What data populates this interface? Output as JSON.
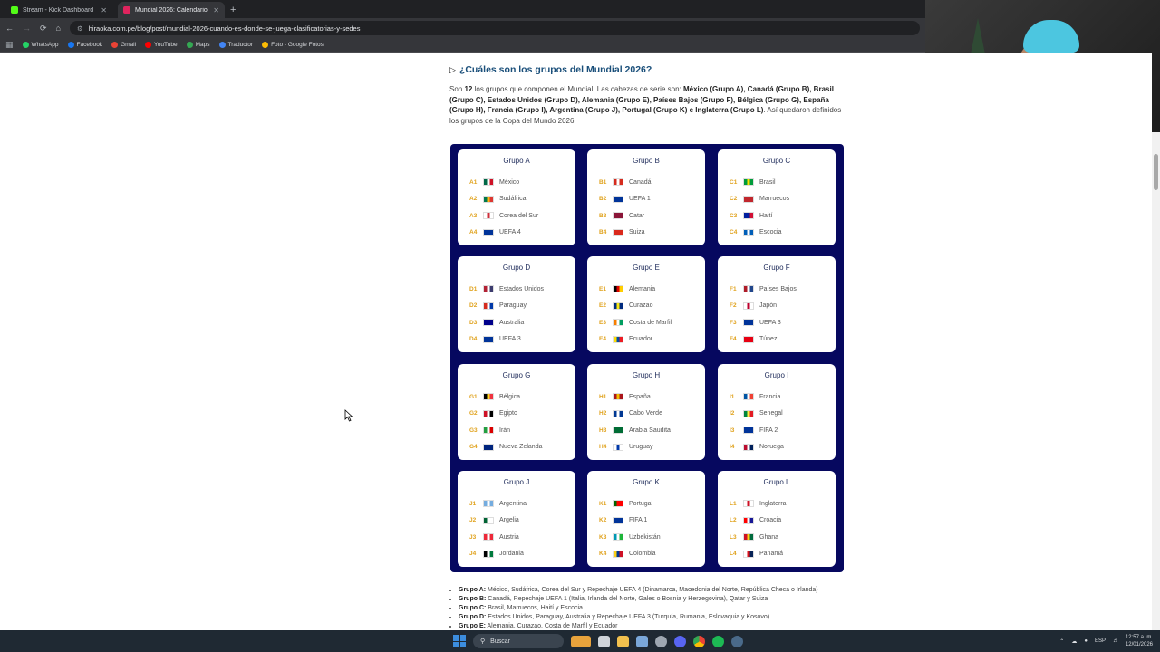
{
  "browser": {
    "tabs": [
      {
        "title": "Stream - Kick Dashboard",
        "color": "#53fc18",
        "active": false
      },
      {
        "title": "Mundial 2026: Calendario co",
        "color": "#e0245e",
        "active": true
      }
    ],
    "url": "hiraoka.com.pe/blog/post/mundial-2026-cuando-es-donde-se-juega-clasificatorias-y-sedes",
    "bookmarks": [
      {
        "label": "WhatsApp",
        "color": "#25d366"
      },
      {
        "label": "Facebook",
        "color": "#1877f2"
      },
      {
        "label": "Gmail",
        "color": "#ea4335"
      },
      {
        "label": "YouTube",
        "color": "#ff0000"
      },
      {
        "label": "Maps",
        "color": "#34a853"
      },
      {
        "label": "Traductor",
        "color": "#4285f4"
      },
      {
        "label": "Foto - Google Fotos",
        "color": "#fbbc05"
      }
    ]
  },
  "article": {
    "question": "¿Cuáles son los grupos del Mundial 2026?",
    "intro_parts": [
      {
        "t": "Son ",
        "b": false
      },
      {
        "t": "12",
        "b": true
      },
      {
        "t": " los grupos que componen el Mundial. Las cabezas de serie son: ",
        "b": false
      },
      {
        "t": "México (Grupo A), Canadá (Grupo B), Brasil (Grupo C), Estados Unidos (Grupo D), Alemania (Grupo E), Países Bajos (Grupo F), Bélgica (Grupo G), España (Grupo H), Francia (Grupo I), Argentina (Grupo J), Portugal (Grupo K) e Inglaterra (Grupo L)",
        "b": true
      },
      {
        "t": ". Así quedaron definidos los grupos de la Copa del Mundo 2026:",
        "b": false
      }
    ],
    "groups": [
      {
        "name": "Grupo A",
        "teams": [
          {
            "code": "A1",
            "name": "México",
            "flag": [
              "#006847",
              "#ffffff",
              "#ce1126"
            ]
          },
          {
            "code": "A2",
            "name": "Sudáfrica",
            "flag": [
              "#007a4d",
              "#ffb612",
              "#de3831"
            ]
          },
          {
            "code": "A3",
            "name": "Corea del Sur",
            "flag": [
              "#ffffff",
              "#cd2e3a",
              "#ffffff"
            ]
          },
          {
            "code": "A4",
            "name": "UEFA 4",
            "flag": [
              "#003399",
              "#003399",
              "#003399"
            ]
          }
        ]
      },
      {
        "name": "Grupo B",
        "teams": [
          {
            "code": "B1",
            "name": "Canadá",
            "flag": [
              "#d52b1e",
              "#ffffff",
              "#d52b1e"
            ]
          },
          {
            "code": "B2",
            "name": "UEFA 1",
            "flag": [
              "#003399",
              "#003399",
              "#003399"
            ]
          },
          {
            "code": "B3",
            "name": "Catar",
            "flag": [
              "#8a1538",
              "#8a1538",
              "#8a1538"
            ]
          },
          {
            "code": "B4",
            "name": "Suiza",
            "flag": [
              "#da291c",
              "#da291c",
              "#da291c"
            ]
          }
        ]
      },
      {
        "name": "Grupo C",
        "teams": [
          {
            "code": "C1",
            "name": "Brasil",
            "flag": [
              "#009c3b",
              "#ffdf00",
              "#009c3b"
            ]
          },
          {
            "code": "C2",
            "name": "Marruecos",
            "flag": [
              "#c1272d",
              "#c1272d",
              "#c1272d"
            ]
          },
          {
            "code": "C3",
            "name": "Haití",
            "flag": [
              "#00209f",
              "#00209f",
              "#d21034"
            ]
          },
          {
            "code": "C4",
            "name": "Escocia",
            "flag": [
              "#005eb8",
              "#ffffff",
              "#005eb8"
            ]
          }
        ]
      },
      {
        "name": "Grupo D",
        "teams": [
          {
            "code": "D1",
            "name": "Estados Unidos",
            "flag": [
              "#b22234",
              "#ffffff",
              "#3c3b6e"
            ]
          },
          {
            "code": "D2",
            "name": "Paraguay",
            "flag": [
              "#d52b1e",
              "#ffffff",
              "#0038a8"
            ]
          },
          {
            "code": "D3",
            "name": "Australia",
            "flag": [
              "#00008b",
              "#00008b",
              "#00008b"
            ]
          },
          {
            "code": "D4",
            "name": "UEFA 3",
            "flag": [
              "#003399",
              "#003399",
              "#003399"
            ]
          }
        ]
      },
      {
        "name": "Grupo E",
        "teams": [
          {
            "code": "E1",
            "name": "Alemania",
            "flag": [
              "#000000",
              "#dd0000",
              "#ffce00"
            ]
          },
          {
            "code": "E2",
            "name": "Curazao",
            "flag": [
              "#002b7f",
              "#f9e814",
              "#002b7f"
            ]
          },
          {
            "code": "E3",
            "name": "Costa de Marfil",
            "flag": [
              "#f77f00",
              "#ffffff",
              "#009e60"
            ]
          },
          {
            "code": "E4",
            "name": "Ecuador",
            "flag": [
              "#ffdd00",
              "#034ea2",
              "#ed1c24"
            ]
          }
        ]
      },
      {
        "name": "Grupo F",
        "teams": [
          {
            "code": "F1",
            "name": "Países Bajos",
            "flag": [
              "#ae1c28",
              "#ffffff",
              "#21468b"
            ]
          },
          {
            "code": "F2",
            "name": "Japón",
            "flag": [
              "#ffffff",
              "#bc002d",
              "#ffffff"
            ]
          },
          {
            "code": "F3",
            "name": "UEFA 3",
            "flag": [
              "#003399",
              "#003399",
              "#003399"
            ]
          },
          {
            "code": "F4",
            "name": "Túnez",
            "flag": [
              "#e70013",
              "#e70013",
              "#e70013"
            ]
          }
        ]
      },
      {
        "name": "Grupo G",
        "teams": [
          {
            "code": "G1",
            "name": "Bélgica",
            "flag": [
              "#000000",
              "#fdda24",
              "#ef3340"
            ]
          },
          {
            "code": "G2",
            "name": "Egipto",
            "flag": [
              "#ce1126",
              "#ffffff",
              "#000000"
            ]
          },
          {
            "code": "G3",
            "name": "Irán",
            "flag": [
              "#239f40",
              "#ffffff",
              "#da0000"
            ]
          },
          {
            "code": "G4",
            "name": "Nueva Zelanda",
            "flag": [
              "#00247d",
              "#00247d",
              "#00247d"
            ]
          }
        ]
      },
      {
        "name": "Grupo H",
        "teams": [
          {
            "code": "H1",
            "name": "España",
            "flag": [
              "#aa151b",
              "#f1bf00",
              "#aa151b"
            ]
          },
          {
            "code": "H2",
            "name": "Cabo Verde",
            "flag": [
              "#003893",
              "#ffffff",
              "#003893"
            ]
          },
          {
            "code": "H3",
            "name": "Arabia Saudita",
            "flag": [
              "#006c35",
              "#006c35",
              "#006c35"
            ]
          },
          {
            "code": "H4",
            "name": "Uruguay",
            "flag": [
              "#ffffff",
              "#0038a8",
              "#ffffff"
            ]
          }
        ]
      },
      {
        "name": "Grupo I",
        "teams": [
          {
            "code": "I1",
            "name": "Francia",
            "flag": [
              "#0055a4",
              "#ffffff",
              "#ef4135"
            ]
          },
          {
            "code": "I2",
            "name": "Senegal",
            "flag": [
              "#00853f",
              "#fdef42",
              "#e31b23"
            ]
          },
          {
            "code": "I3",
            "name": "FIFA 2",
            "flag": [
              "#003399",
              "#003399",
              "#003399"
            ]
          },
          {
            "code": "I4",
            "name": "Noruega",
            "flag": [
              "#ba0c2f",
              "#ffffff",
              "#00205b"
            ]
          }
        ]
      },
      {
        "name": "Grupo J",
        "teams": [
          {
            "code": "J1",
            "name": "Argentina",
            "flag": [
              "#74acdf",
              "#ffffff",
              "#74acdf"
            ]
          },
          {
            "code": "J2",
            "name": "Argelia",
            "flag": [
              "#006233",
              "#ffffff",
              "#ffffff"
            ]
          },
          {
            "code": "J3",
            "name": "Austria",
            "flag": [
              "#ed2939",
              "#ffffff",
              "#ed2939"
            ]
          },
          {
            "code": "J4",
            "name": "Jordania",
            "flag": [
              "#000000",
              "#ffffff",
              "#007a3d"
            ]
          }
        ]
      },
      {
        "name": "Grupo K",
        "teams": [
          {
            "code": "K1",
            "name": "Portugal",
            "flag": [
              "#006600",
              "#ff0000",
              "#ff0000"
            ]
          },
          {
            "code": "K2",
            "name": "FIFA 1",
            "flag": [
              "#003399",
              "#003399",
              "#003399"
            ]
          },
          {
            "code": "K3",
            "name": "Uzbekistán",
            "flag": [
              "#0099b5",
              "#ffffff",
              "#1eb53a"
            ]
          },
          {
            "code": "K4",
            "name": "Colombia",
            "flag": [
              "#fcd116",
              "#003893",
              "#ce1126"
            ]
          }
        ]
      },
      {
        "name": "Grupo L",
        "teams": [
          {
            "code": "L1",
            "name": "Inglaterra",
            "flag": [
              "#ffffff",
              "#ce1124",
              "#ffffff"
            ]
          },
          {
            "code": "L2",
            "name": "Croacia",
            "flag": [
              "#ff0000",
              "#ffffff",
              "#171796"
            ]
          },
          {
            "code": "L3",
            "name": "Ghana",
            "flag": [
              "#ce1126",
              "#fcd116",
              "#006b3f"
            ]
          },
          {
            "code": "L4",
            "name": "Panamá",
            "flag": [
              "#ffffff",
              "#da121a",
              "#072357"
            ]
          }
        ]
      }
    ],
    "summary": [
      {
        "label": "Grupo A:",
        "text": " México, Sudáfrica, Corea del Sur y Repechaje UEFA 4 (Dinamarca, Macedonia del Norte, República Checa o Irlanda)"
      },
      {
        "label": "Grupo B:",
        "text": " Canadá, Repechaje UEFA 1 (Italia, Irlanda del Norte, Gales o Bosnia y Herzegovina), Qatar y Suiza"
      },
      {
        "label": "Grupo C:",
        "text": " Brasil, Marruecos, Haití y Escocia"
      },
      {
        "label": "Grupo D:",
        "text": " Estados Unidos, Paraguay, Australia y Repechaje UEFA 3 (Turquía, Rumania, Eslovaquia y Kosovo)"
      },
      {
        "label": "Grupo E:",
        "text": " Alemania, Curazao, Costa de Marfil y Ecuador"
      }
    ]
  },
  "taskbar": {
    "search_label": "Buscar",
    "lang": "ESP",
    "time": "12:57 a. m.",
    "date": "12/01/2026"
  }
}
